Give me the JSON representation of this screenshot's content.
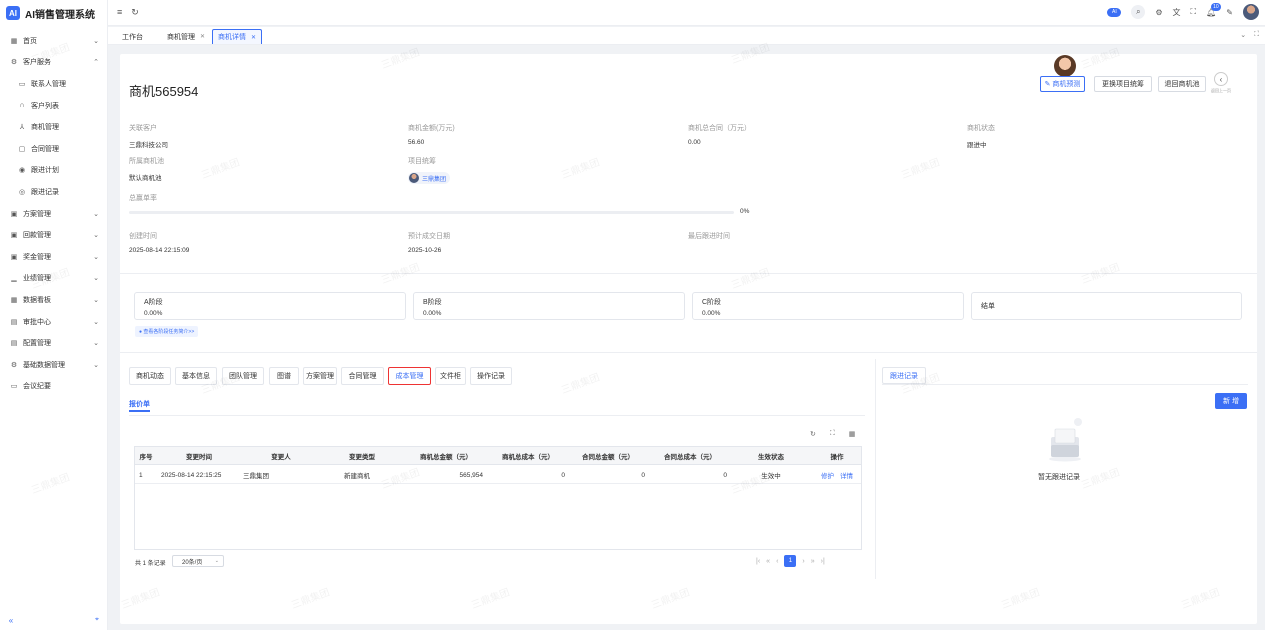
{
  "app": {
    "title": "AI销售管理系统",
    "logo_text": "AI"
  },
  "sidebar": {
    "items": [
      {
        "label": "首页",
        "icon": "grid-icon",
        "chev": "⌄",
        "sub": false
      },
      {
        "label": "客户服务",
        "icon": "gear-icon",
        "chev": "⌃",
        "sub": false
      },
      {
        "label": "联系人管理",
        "icon": "contact-card-icon",
        "chev": "",
        "sub": true
      },
      {
        "label": "客户列表",
        "icon": "headset-icon",
        "chev": "",
        "sub": true
      },
      {
        "label": "商机管理",
        "icon": "network-icon",
        "chev": "",
        "sub": true
      },
      {
        "label": "合同管理",
        "icon": "document-icon",
        "chev": "",
        "sub": true
      },
      {
        "label": "跟进计划",
        "icon": "target-icon",
        "chev": "",
        "sub": true
      },
      {
        "label": "跟进记录",
        "icon": "record-icon",
        "chev": "",
        "sub": true
      },
      {
        "label": "方案管理",
        "icon": "plan-icon",
        "chev": "⌄",
        "sub": false
      },
      {
        "label": "回款管理",
        "icon": "payment-icon",
        "chev": "⌄",
        "sub": false
      },
      {
        "label": "奖金管理",
        "icon": "bonus-icon",
        "chev": "⌄",
        "sub": false
      },
      {
        "label": "业绩管理",
        "icon": "chart-icon",
        "chev": "⌄",
        "sub": false
      },
      {
        "label": "数据看板",
        "icon": "dashboard-icon",
        "chev": "⌄",
        "sub": false
      },
      {
        "label": "审批中心",
        "icon": "approval-icon",
        "chev": "⌄",
        "sub": false
      },
      {
        "label": "配置管理",
        "icon": "config-icon",
        "chev": "⌄",
        "sub": false
      },
      {
        "label": "基础数据管理",
        "icon": "database-icon",
        "chev": "⌄",
        "sub": false
      },
      {
        "label": "会议纪要",
        "icon": "meeting-icon",
        "chev": "",
        "sub": false
      }
    ]
  },
  "topbar": {
    "notification_count": "10",
    "pill_text": "AI"
  },
  "tabs": [
    {
      "label": "工作台",
      "closable": false
    },
    {
      "label": "商机管理",
      "closable": true
    },
    {
      "label": "商机详情",
      "closable": true,
      "active": true
    }
  ],
  "detail": {
    "title": "商机565954",
    "buttons": {
      "predict": "商机预测",
      "change_owner": "更换项目统筹",
      "return_pool": "退回商机池",
      "back": "返回上一页"
    },
    "fields": {
      "customer_label": "关联客户",
      "customer_value": "三鼎科技公司",
      "amount_label": "商机金额(万元)",
      "amount_value": "56.60",
      "contract_label": "商机总合同（万元）",
      "contract_value": "0.00",
      "status_label": "商机状态",
      "status_value": "跟进中",
      "pool_label": "所属商机池",
      "pool_value": "默认商机池",
      "owner_label": "项目统筹",
      "owner_value": "三鼎集团",
      "win_rate_label": "总赢单率",
      "win_rate_value": "0%",
      "win_rate_fraction": 0,
      "created_label": "创建时间",
      "created_value": "2025-08-14 22:15:09",
      "expected_label": "预计成交日期",
      "expected_value": "2025-10-26",
      "last_follow_label": "最后跟进时间",
      "last_follow_value": ""
    },
    "stages": [
      {
        "name": "A阶段",
        "pct": "0.00%"
      },
      {
        "name": "B阶段",
        "pct": "0.00%"
      },
      {
        "name": "C阶段",
        "pct": "0.00%"
      },
      {
        "name": "结单",
        "pct": ""
      }
    ],
    "stage_link": "查看各阶段任务简介>>"
  },
  "detail_tabs": [
    "商机动态",
    "基本信息",
    "团队管理",
    "图谱",
    "方案管理",
    "合同管理",
    "成本管理",
    "文件柜",
    "操作记录"
  ],
  "active_detail_tab": "成本管理",
  "quote": {
    "subtab": "报价单",
    "columns": [
      "序号",
      "变更时间",
      "变更人",
      "变更类型",
      "商机总金额（元）",
      "商机总成本（元）",
      "合同总金额（元）",
      "合同总成本（元）",
      "生效状态",
      "操作"
    ],
    "rows": [
      {
        "idx": "1",
        "time": "2025-08-14 22:15:25",
        "user": "三鼎集团",
        "type": "新建商机",
        "amount": "565,954",
        "cost": "0",
        "contract_amount": "0",
        "contract_cost": "0",
        "status": "生效中",
        "op1": "修护",
        "op2": "详情"
      }
    ],
    "total": "共 1 条记录",
    "page_size": "20条/页",
    "current_page": "1"
  },
  "follow": {
    "tab": "跟进记录",
    "new_btn": "新 增",
    "empty": "暂无跟进记录"
  },
  "watermark": "三鼎集团",
  "colors": {
    "accent": "#3b6ff5",
    "highlight_border": "#e33333"
  }
}
